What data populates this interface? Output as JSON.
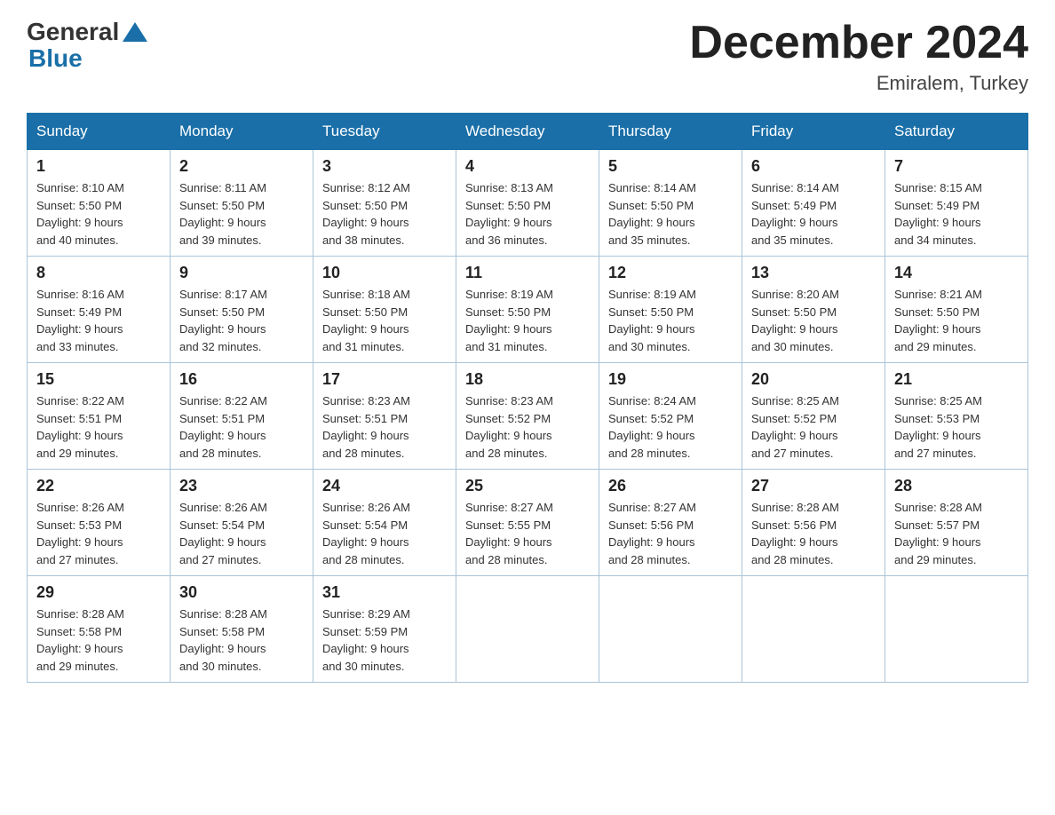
{
  "logo": {
    "general": "General",
    "blue": "Blue"
  },
  "title": "December 2024",
  "subtitle": "Emiralem, Turkey",
  "days_of_week": [
    "Sunday",
    "Monday",
    "Tuesday",
    "Wednesday",
    "Thursday",
    "Friday",
    "Saturday"
  ],
  "weeks": [
    [
      {
        "day": "1",
        "sunrise": "8:10 AM",
        "sunset": "5:50 PM",
        "daylight": "9 hours and 40 minutes."
      },
      {
        "day": "2",
        "sunrise": "8:11 AM",
        "sunset": "5:50 PM",
        "daylight": "9 hours and 39 minutes."
      },
      {
        "day": "3",
        "sunrise": "8:12 AM",
        "sunset": "5:50 PM",
        "daylight": "9 hours and 38 minutes."
      },
      {
        "day": "4",
        "sunrise": "8:13 AM",
        "sunset": "5:50 PM",
        "daylight": "9 hours and 36 minutes."
      },
      {
        "day": "5",
        "sunrise": "8:14 AM",
        "sunset": "5:50 PM",
        "daylight": "9 hours and 35 minutes."
      },
      {
        "day": "6",
        "sunrise": "8:14 AM",
        "sunset": "5:49 PM",
        "daylight": "9 hours and 35 minutes."
      },
      {
        "day": "7",
        "sunrise": "8:15 AM",
        "sunset": "5:49 PM",
        "daylight": "9 hours and 34 minutes."
      }
    ],
    [
      {
        "day": "8",
        "sunrise": "8:16 AM",
        "sunset": "5:49 PM",
        "daylight": "9 hours and 33 minutes."
      },
      {
        "day": "9",
        "sunrise": "8:17 AM",
        "sunset": "5:50 PM",
        "daylight": "9 hours and 32 minutes."
      },
      {
        "day": "10",
        "sunrise": "8:18 AM",
        "sunset": "5:50 PM",
        "daylight": "9 hours and 31 minutes."
      },
      {
        "day": "11",
        "sunrise": "8:19 AM",
        "sunset": "5:50 PM",
        "daylight": "9 hours and 31 minutes."
      },
      {
        "day": "12",
        "sunrise": "8:19 AM",
        "sunset": "5:50 PM",
        "daylight": "9 hours and 30 minutes."
      },
      {
        "day": "13",
        "sunrise": "8:20 AM",
        "sunset": "5:50 PM",
        "daylight": "9 hours and 30 minutes."
      },
      {
        "day": "14",
        "sunrise": "8:21 AM",
        "sunset": "5:50 PM",
        "daylight": "9 hours and 29 minutes."
      }
    ],
    [
      {
        "day": "15",
        "sunrise": "8:22 AM",
        "sunset": "5:51 PM",
        "daylight": "9 hours and 29 minutes."
      },
      {
        "day": "16",
        "sunrise": "8:22 AM",
        "sunset": "5:51 PM",
        "daylight": "9 hours and 28 minutes."
      },
      {
        "day": "17",
        "sunrise": "8:23 AM",
        "sunset": "5:51 PM",
        "daylight": "9 hours and 28 minutes."
      },
      {
        "day": "18",
        "sunrise": "8:23 AM",
        "sunset": "5:52 PM",
        "daylight": "9 hours and 28 minutes."
      },
      {
        "day": "19",
        "sunrise": "8:24 AM",
        "sunset": "5:52 PM",
        "daylight": "9 hours and 28 minutes."
      },
      {
        "day": "20",
        "sunrise": "8:25 AM",
        "sunset": "5:52 PM",
        "daylight": "9 hours and 27 minutes."
      },
      {
        "day": "21",
        "sunrise": "8:25 AM",
        "sunset": "5:53 PM",
        "daylight": "9 hours and 27 minutes."
      }
    ],
    [
      {
        "day": "22",
        "sunrise": "8:26 AM",
        "sunset": "5:53 PM",
        "daylight": "9 hours and 27 minutes."
      },
      {
        "day": "23",
        "sunrise": "8:26 AM",
        "sunset": "5:54 PM",
        "daylight": "9 hours and 27 minutes."
      },
      {
        "day": "24",
        "sunrise": "8:26 AM",
        "sunset": "5:54 PM",
        "daylight": "9 hours and 28 minutes."
      },
      {
        "day": "25",
        "sunrise": "8:27 AM",
        "sunset": "5:55 PM",
        "daylight": "9 hours and 28 minutes."
      },
      {
        "day": "26",
        "sunrise": "8:27 AM",
        "sunset": "5:56 PM",
        "daylight": "9 hours and 28 minutes."
      },
      {
        "day": "27",
        "sunrise": "8:28 AM",
        "sunset": "5:56 PM",
        "daylight": "9 hours and 28 minutes."
      },
      {
        "day": "28",
        "sunrise": "8:28 AM",
        "sunset": "5:57 PM",
        "daylight": "9 hours and 29 minutes."
      }
    ],
    [
      {
        "day": "29",
        "sunrise": "8:28 AM",
        "sunset": "5:58 PM",
        "daylight": "9 hours and 29 minutes."
      },
      {
        "day": "30",
        "sunrise": "8:28 AM",
        "sunset": "5:58 PM",
        "daylight": "9 hours and 30 minutes."
      },
      {
        "day": "31",
        "sunrise": "8:29 AM",
        "sunset": "5:59 PM",
        "daylight": "9 hours and 30 minutes."
      },
      null,
      null,
      null,
      null
    ]
  ],
  "labels": {
    "sunrise": "Sunrise:",
    "sunset": "Sunset:",
    "daylight": "Daylight:"
  }
}
